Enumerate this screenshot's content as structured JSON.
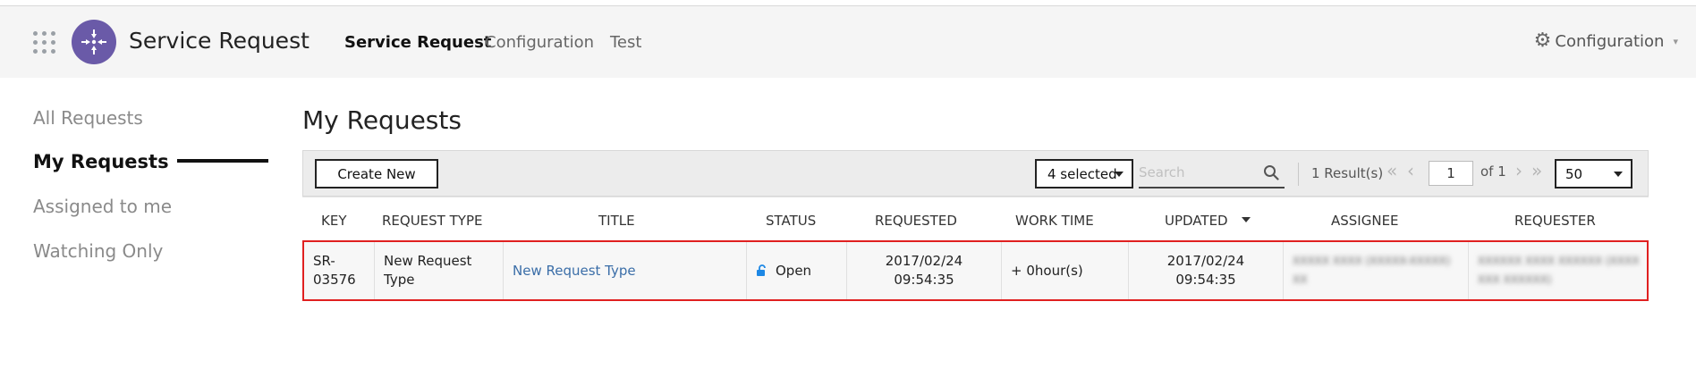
{
  "header": {
    "app_title": "Service Request",
    "nav": [
      "Service Request",
      "Configuration",
      "Test"
    ],
    "config_label": "Configuration",
    "icons": {
      "apps": "apps-grid-icon",
      "logo": "arrows-converge-icon",
      "settings": "gear-icon"
    }
  },
  "sidebar": {
    "items": [
      {
        "label": "All Requests"
      },
      {
        "label": "My Requests",
        "active": true
      },
      {
        "label": "Assigned to me"
      },
      {
        "label": "Watching Only"
      }
    ]
  },
  "main": {
    "title": "My Requests"
  },
  "toolbar": {
    "create_label": "Create New",
    "filter_value": "4 selected",
    "search_placeholder": "Search",
    "results_text": "1 Result(s)",
    "page_value": "1",
    "page_of": "of 1",
    "page_size": "50"
  },
  "table": {
    "columns": [
      "KEY",
      "REQUEST TYPE",
      "TITLE",
      "STATUS",
      "REQUESTED",
      "WORK TIME",
      "UPDATED",
      "ASSIGNEE",
      "REQUESTER"
    ],
    "rows": [
      {
        "key_line1": "SR-",
        "key_line2": "03576",
        "type_line1": "New Request",
        "type_line2": "Type",
        "title": "New Request Type",
        "status": "Open",
        "requested_date": "2017/02/24",
        "requested_time": "09:54:35",
        "work_time": "+ 0hour(s)",
        "updated_date": "2017/02/24",
        "updated_time": "09:54:35",
        "assignee_line1": "XXXXX XXXX (XXXXX-XXXXX)",
        "assignee_line2": "XX",
        "requester_line1": "XXXXXX XXXX XXXXXX (XXXX",
        "requester_line2": "XXX XXXXXX)"
      }
    ]
  },
  "colors": {
    "accent": "#6a5aa8",
    "link": "#3b6ea8",
    "highlight_border": "#e02020",
    "status_lock": "#1e88e5"
  }
}
